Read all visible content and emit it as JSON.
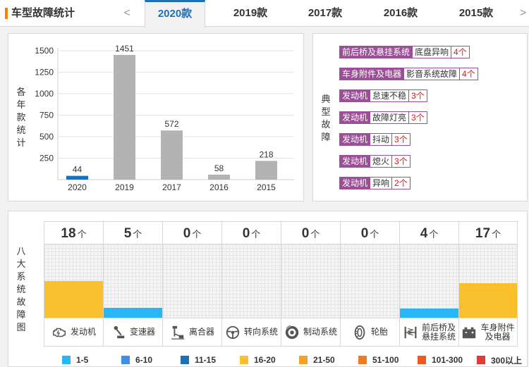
{
  "header": {
    "title": "车型故障统计",
    "prev": "<",
    "next": ">",
    "tabs": [
      {
        "label": "2020款",
        "active": true
      },
      {
        "label": "2019款",
        "active": false
      },
      {
        "label": "2017款",
        "active": false
      },
      {
        "label": "2016款",
        "active": false
      },
      {
        "label": "2015款",
        "active": false
      }
    ]
  },
  "year_chart": {
    "side_label": "各年款统计",
    "chart_data": {
      "type": "bar",
      "categories": [
        "2020",
        "2019",
        "2017",
        "2016",
        "2015"
      ],
      "values": [
        44,
        1451,
        572,
        58,
        218
      ],
      "highlight": "2020",
      "colors": {
        "highlight": "#1e6fb7",
        "default": "#b3b3b3"
      },
      "yticks": [
        250,
        500,
        750,
        1000,
        1250,
        1500
      ],
      "ylim": [
        0,
        1500
      ],
      "grid": true
    }
  },
  "typical_faults": {
    "side_label": "典型故障",
    "items": [
      {
        "category": "前后桥及悬挂系统",
        "item": "底盘异响",
        "count": "4个"
      },
      {
        "category": "车身附件及电器",
        "item": "影音系统故障",
        "count": "4个"
      },
      {
        "category": "发动机",
        "item": "怠速不稳",
        "count": "3个"
      },
      {
        "category": "发动机",
        "item": "故障灯亮",
        "count": "3个"
      },
      {
        "category": "发动机",
        "item": "抖动",
        "count": "3个"
      },
      {
        "category": "发动机",
        "item": "熄火",
        "count": "3个"
      },
      {
        "category": "发动机",
        "item": "异响",
        "count": "2个"
      }
    ]
  },
  "systems": {
    "side_label": "八大系统故障图",
    "unit": "个",
    "max": 20,
    "items": [
      {
        "name": "发动机",
        "count": 18,
        "icon": "engine-icon",
        "color": "#fbc02d"
      },
      {
        "name": "变速器",
        "count": 5,
        "icon": "gear-shift-icon",
        "color": "#29b6f6"
      },
      {
        "name": "离合器",
        "count": 0,
        "icon": "clutch-pedal-icon",
        "color": "#29b6f6"
      },
      {
        "name": "转向系统",
        "count": 0,
        "icon": "steering-wheel-icon",
        "color": "#29b6f6"
      },
      {
        "name": "制动系统",
        "count": 0,
        "icon": "brake-disc-icon",
        "color": "#29b6f6"
      },
      {
        "name": "轮胎",
        "count": 0,
        "icon": "tire-icon",
        "color": "#29b6f6"
      },
      {
        "name": "前后桥及悬挂系统",
        "name_lines": [
          "前后桥及",
          "悬挂系统"
        ],
        "count": 4,
        "icon": "suspension-icon",
        "color": "#29b6f6"
      },
      {
        "name": "车身附件及电器",
        "name_lines": [
          "车身附件",
          "及电器"
        ],
        "count": 17,
        "icon": "battery-icon",
        "color": "#fbc02d"
      }
    ],
    "legend": [
      {
        "label": "1-5",
        "color": "#29b6f6"
      },
      {
        "label": "6-10",
        "color": "#3d8fe8"
      },
      {
        "label": "11-15",
        "color": "#1e6fb7"
      },
      {
        "label": "16-20",
        "color": "#fbc02d"
      },
      {
        "label": "21-50",
        "color": "#f5a12a"
      },
      {
        "label": "51-100",
        "color": "#f07a25"
      },
      {
        "label": "101-300",
        "color": "#ee5a20"
      },
      {
        "label": "300以上",
        "color": "#e53935"
      }
    ]
  }
}
